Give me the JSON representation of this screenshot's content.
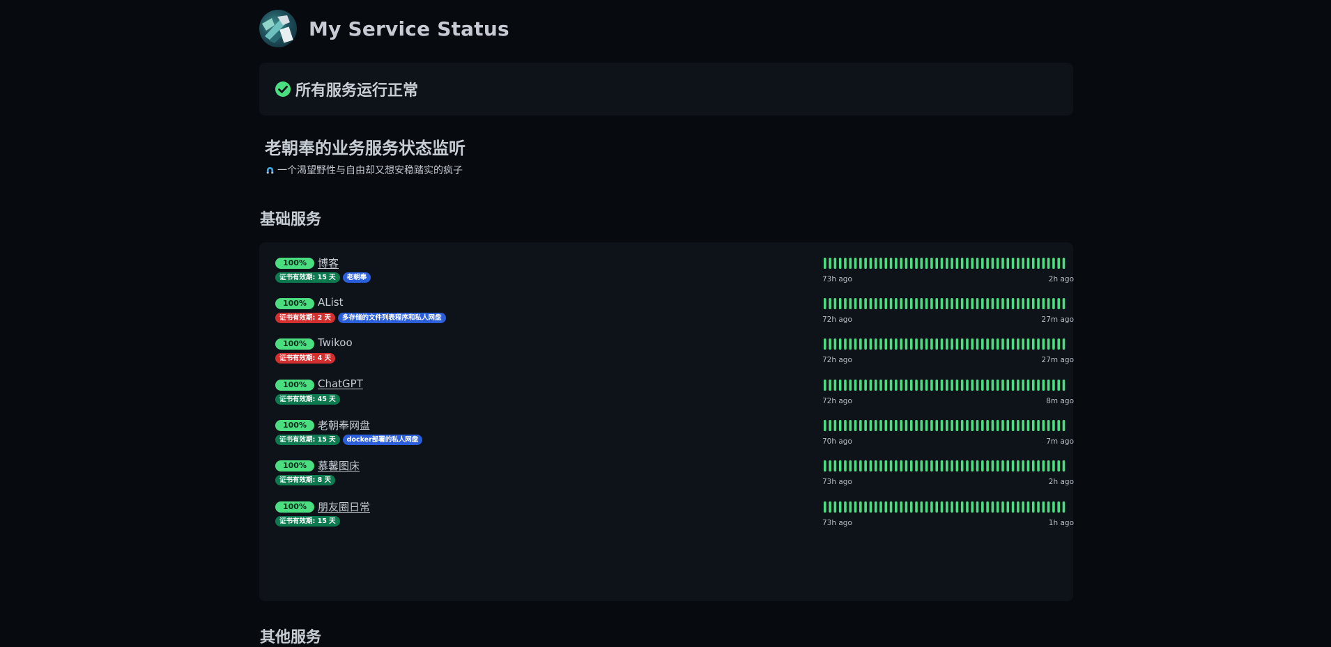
{
  "header": {
    "site_title": "My Service Status",
    "avatar_icon": "avatar-image"
  },
  "status_banner": {
    "icon": "check-circle-icon",
    "text": "所有服务运行正常",
    "color": "#4ade80"
  },
  "description": {
    "title": "老朝奉的业务服务状态监听",
    "subtitle": "一个渴望野性与自由却又想安稳踏实的疯子",
    "subtitle_icon": "magnet-icon"
  },
  "groups": [
    {
      "title": "基础服务",
      "services": [
        {
          "uptime": "100%",
          "name": "博客",
          "linked": true,
          "tags": [
            {
              "text": "证书有效期: 15 天",
              "color": "green"
            },
            {
              "text": "老朝奉",
              "color": "blue"
            }
          ],
          "time_start": "73h ago",
          "time_end": "2h ago"
        },
        {
          "uptime": "100%",
          "name": "AList",
          "linked": false,
          "tags": [
            {
              "text": "证书有效期: 2 天",
              "color": "red"
            },
            {
              "text": "多存储的文件列表程序和私人网盘",
              "color": "blue"
            }
          ],
          "time_start": "72h ago",
          "time_end": "27m ago"
        },
        {
          "uptime": "100%",
          "name": "Twikoo",
          "linked": false,
          "tags": [
            {
              "text": "证书有效期: 4 天",
              "color": "red"
            }
          ],
          "time_start": "72h ago",
          "time_end": "27m ago"
        },
        {
          "uptime": "100%",
          "name": "ChatGPT",
          "linked": true,
          "tags": [
            {
              "text": "证书有效期: 45 天",
              "color": "green"
            }
          ],
          "time_start": "72h ago",
          "time_end": "8m ago"
        },
        {
          "uptime": "100%",
          "name": "老朝奉网盘",
          "linked": false,
          "tags": [
            {
              "text": "证书有效期: 15 天",
              "color": "green"
            },
            {
              "text": "docker部署的私人网盘",
              "color": "blue"
            }
          ],
          "time_start": "70h ago",
          "time_end": "7m ago"
        },
        {
          "uptime": "100%",
          "name": "慕馨图床",
          "linked": true,
          "tags": [
            {
              "text": "证书有效期: 8 天",
              "color": "green"
            }
          ],
          "time_start": "73h ago",
          "time_end": "2h ago"
        },
        {
          "uptime": "100%",
          "name": "朋友圈日常",
          "linked": true,
          "tags": [
            {
              "text": "证书有效期: 15 天",
              "color": "green"
            }
          ],
          "time_start": "73h ago",
          "time_end": "1h ago"
        }
      ]
    }
  ],
  "next_group_title": "其他服务",
  "colors": {
    "background": "#070a0f",
    "card": "#0e1219",
    "up_green": "#4ade80",
    "tag_green": "#0d7a50",
    "tag_red": "#d32f2f",
    "tag_blue": "#2b5fd9"
  }
}
